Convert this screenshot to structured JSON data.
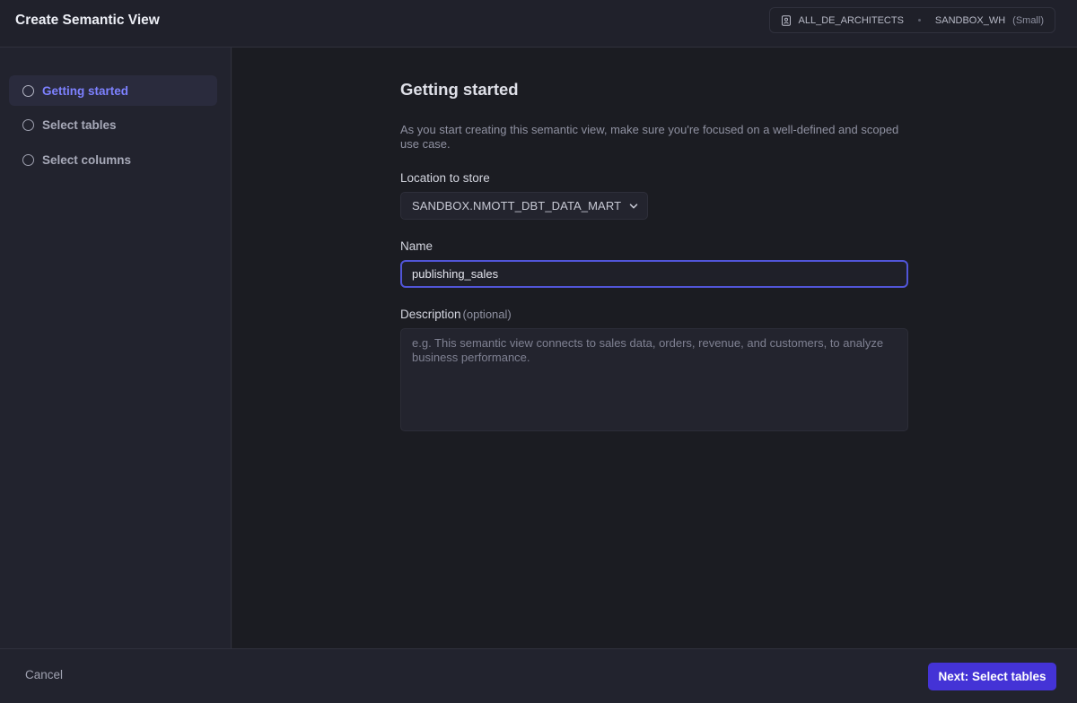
{
  "header": {
    "title": "Create Semantic View",
    "role": "ALL_DE_ARCHITECTS",
    "warehouse": "SANDBOX_WH",
    "warehouse_size": "(Small)",
    "role_icon": "user-badge-icon"
  },
  "sidebar": {
    "steps": [
      {
        "label": "Getting started",
        "active": true
      },
      {
        "label": "Select tables",
        "active": false
      },
      {
        "label": "Select columns",
        "active": false
      }
    ]
  },
  "main": {
    "title": "Getting started",
    "intro": "As you start creating this semantic view, make sure you're focused on a well-defined and scoped use case.",
    "location": {
      "label": "Location to store",
      "value": "SANDBOX.NMOTT_DBT_DATA_MART"
    },
    "name": {
      "label": "Name",
      "value": "publishing_sales"
    },
    "description": {
      "label": "Description",
      "optional_label": "(optional)",
      "placeholder": "e.g. This semantic view connects to sales data, orders, revenue, and customers, to analyze business performance.",
      "value": ""
    }
  },
  "footer": {
    "cancel_label": "Cancel",
    "next_label": "Next: Select tables"
  },
  "colors": {
    "accent": "#4433d6",
    "active_step_text": "#7d81ff",
    "focus_ring": "#5155d8"
  }
}
